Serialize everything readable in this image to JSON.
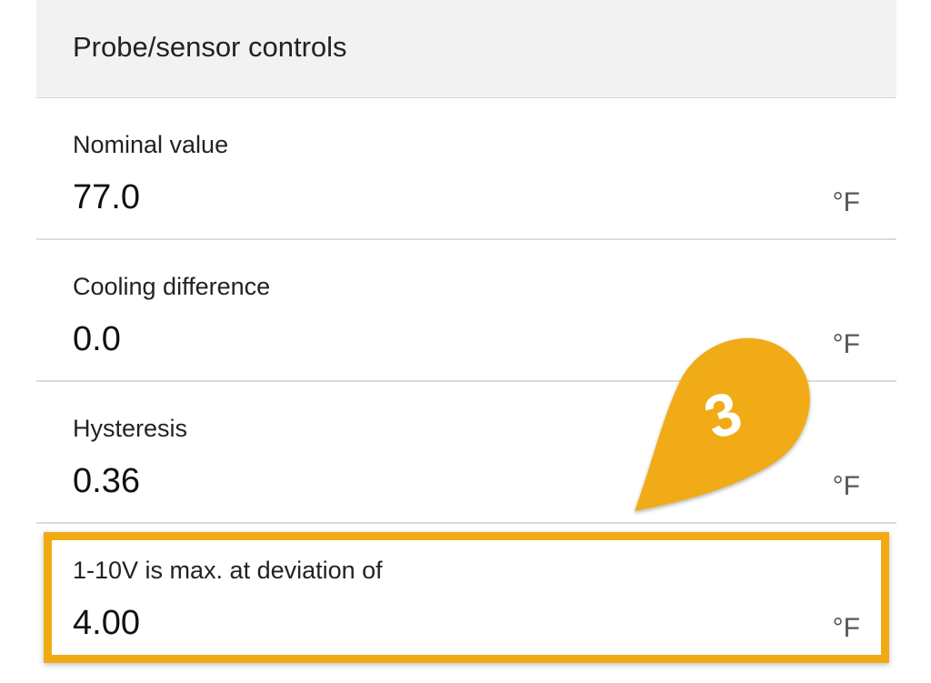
{
  "panel": {
    "title": "Probe/sensor controls"
  },
  "rows": [
    {
      "label": "Nominal value",
      "value": "77.0",
      "unit": "°F"
    },
    {
      "label": "Cooling difference",
      "value": "0.0",
      "unit": "°F"
    },
    {
      "label": "Hysteresis",
      "value": "0.36",
      "unit": "°F"
    },
    {
      "label": "1-10V is max. at deviation of",
      "value": "4.00",
      "unit": "°F"
    }
  ],
  "callout": {
    "number": "3",
    "color": "#f0ab14"
  },
  "highlight": {
    "color": "#f0ab14"
  }
}
